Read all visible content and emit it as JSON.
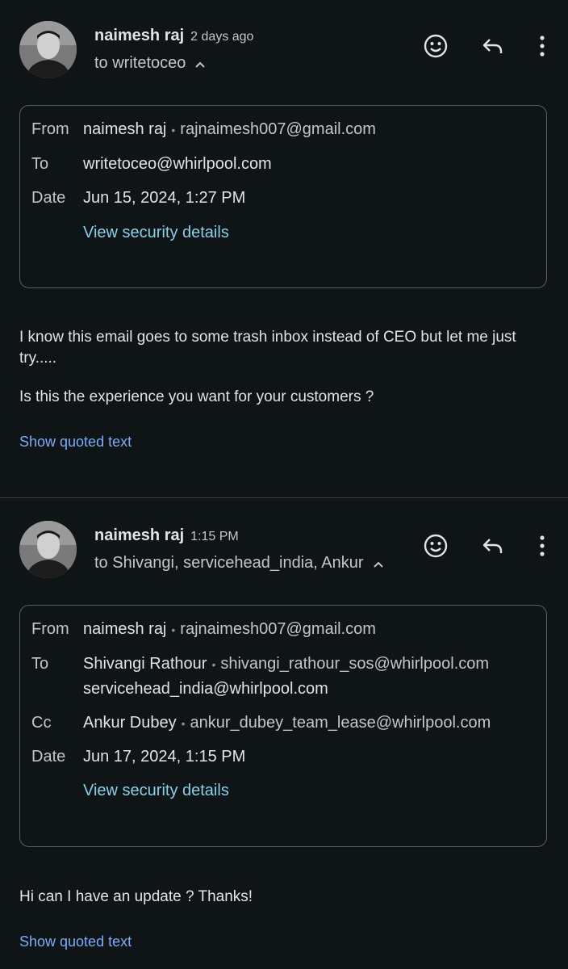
{
  "messages": [
    {
      "sender": "naimesh raj",
      "time": "2 days ago",
      "recipients": "to writetoceo",
      "details": {
        "from_label": "From",
        "from_name": "naimesh raj",
        "from_email": "rajnaimesh007@gmail.com",
        "to_label": "To",
        "to_line1": "writetoceo@whirlpool.com",
        "date_label": "Date",
        "date": "Jun 15, 2024, 1:27 PM",
        "security_link": "View security details"
      },
      "body_line1": "I know this email goes to some trash inbox instead of CEO but let me just",
      "body_line2": "try.....",
      "body_line3": "Is this the experience you want for your customers ?",
      "show_quoted": "Show quoted text"
    },
    {
      "sender": "naimesh raj",
      "time": "1:15 PM",
      "recipients": "to Shivangi, servicehead_india, Ankur",
      "details": {
        "from_label": "From",
        "from_name": "naimesh raj",
        "from_email": "rajnaimesh007@gmail.com",
        "to_label": "To",
        "to_name": "Shivangi Rathour",
        "to_email": "shivangi_rathour_sos@whirlpool.com",
        "to_line2": "servicehead_india@whirlpool.com",
        "cc_label": "Cc",
        "cc_name": "Ankur Dubey",
        "cc_email": "ankur_dubey_team_lease@whirlpool.com",
        "date_label": "Date",
        "date": "Jun 17, 2024, 1:15 PM",
        "security_link": "View security details"
      },
      "body_line1": "Hi can I have an update ? Thanks!",
      "show_quoted": "Show quoted text"
    }
  ],
  "icons": [
    "emoji-react-icon",
    "reply-icon",
    "more-vert-icon",
    "chevron-up-icon"
  ],
  "colors": {
    "background": "#0f1417",
    "link": "#7cacf8",
    "security_link": "#8ad0e6",
    "border": "#5a5f63"
  }
}
